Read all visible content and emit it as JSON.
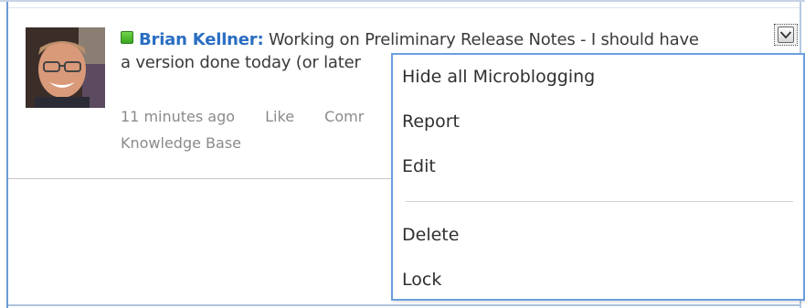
{
  "post": {
    "author": "Brian Kellner",
    "separator": ":",
    "text_line1": " Working on Preliminary Release Notes - I should have",
    "text_line2": "a version done today (or later",
    "timestamp": "11 minutes ago",
    "like_label": "Like",
    "comment_label": "Comr",
    "category": "Knowledge Base",
    "status_icon": "online-status-icon",
    "avatar_icon": "user-avatar"
  },
  "menu": {
    "items": [
      {
        "label": "Hide all Microblogging"
      },
      {
        "label": "Report"
      },
      {
        "label": "Edit"
      },
      {
        "label": "Delete"
      },
      {
        "label": "Lock"
      }
    ]
  },
  "colors": {
    "accent": "#2a6ec2",
    "menu_border": "#6b9fde",
    "status_green": "#3aa620"
  }
}
